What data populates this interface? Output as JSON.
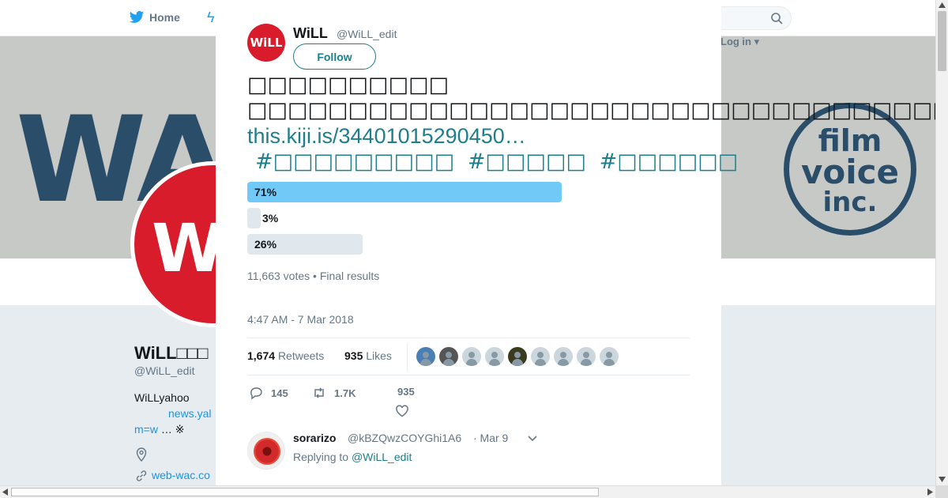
{
  "topnav": {
    "home_label": "Home",
    "login_label": "Log in ▾"
  },
  "profile": {
    "name": "WiLL□□□",
    "handle": "@WiLL_edit",
    "bio_line1": "WiLLyahoo",
    "bio_link1": "news.yal",
    "bio_line2_link": "m=w",
    "bio_line2_rest": "  … ※",
    "website": "web-wac.co"
  },
  "modal": {
    "author_name": "WiLL",
    "author_handle": "@WiLL_edit",
    "avatar_text": "WiLL",
    "follow_label": "Follow",
    "text_line1": "□□□□□□□□□□",
    "text_line2": "□□□□□□□□□□□□□□□□□□□□□□□□□□□□□□□□□□□□□□□□□□□□□□□□□□□□□□□□□□□□",
    "url": "this.kiji.is/34401015290450…",
    "hashtags": [
      "#□□□□□□□□□",
      "#□□□□□",
      "#□□□□□□"
    ],
    "poll": [
      {
        "percent_label": "71%",
        "value": 71,
        "leading": true
      },
      {
        "percent_label": "3%",
        "value": 3,
        "leading": false
      },
      {
        "percent_label": "26%",
        "value": 26,
        "leading": false
      }
    ],
    "poll_meta": "11,663 votes • Final results",
    "timestamp": "4:47 AM - 7 Mar 2018",
    "retweets_count": "1,674",
    "retweets_label": "Retweets",
    "likes_count": "935",
    "likes_label": "Likes",
    "actions": {
      "replies": "145",
      "retweets": "1.7K",
      "likes": "935"
    },
    "reply": {
      "name": "sorarizo",
      "handle": "@kBZQwzCOYGhi1A6",
      "date": "· Mar 9",
      "replying_prefix": "Replying to",
      "replying_to": "@WiLL_edit"
    }
  },
  "colors": {
    "accent": "#1d7f8c",
    "poll_leading": "#71c9f8",
    "poll_other": "#e1e8ed",
    "brand_red": "#d81c2b"
  }
}
